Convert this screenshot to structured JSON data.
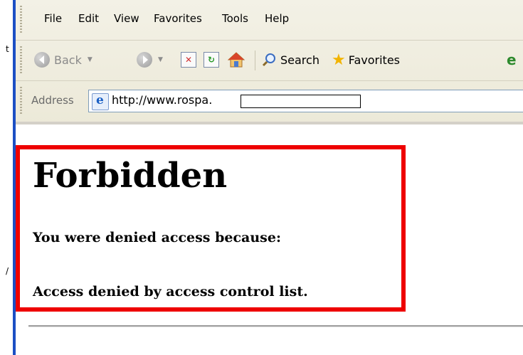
{
  "background_window": {
    "fragments": [
      "t",
      "/"
    ]
  },
  "menu": {
    "items": [
      "File",
      "Edit",
      "View",
      "Favorites",
      "Tools",
      "Help"
    ]
  },
  "toolbar": {
    "back_label": "Back",
    "search_label": "Search",
    "favorites_label": "Favorites",
    "icons": [
      "back-arrow-icon",
      "forward-arrow-icon",
      "stop-icon",
      "refresh-icon",
      "home-icon",
      "search-icon",
      "favorites-star-icon",
      "media-icon"
    ]
  },
  "address": {
    "label": "Address",
    "url": "http://www.rospa."
  },
  "page": {
    "heading": "Forbidden",
    "reason_intro": "You were denied access because:",
    "reason": "Access denied by access control list."
  },
  "colors": {
    "highlight": "#ee0000",
    "chrome": "#ece9d8",
    "window_edge": "#1c4fc4"
  }
}
